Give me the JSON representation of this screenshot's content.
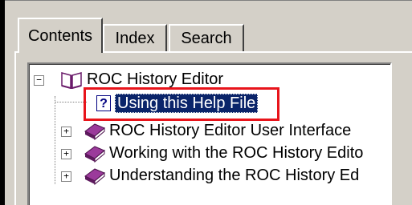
{
  "tabs": [
    {
      "label": "Contents",
      "active": true
    },
    {
      "label": "Index",
      "active": false
    },
    {
      "label": "Search",
      "active": false
    }
  ],
  "tree": {
    "root": {
      "label": "ROC History Editor",
      "icon": "open-book-icon",
      "expanded": true
    },
    "items": [
      {
        "label": "Using this Help File",
        "icon": "help-page-icon",
        "selected": true
      },
      {
        "label": "ROC History Editor User Interface",
        "icon": "closed-book-icon",
        "expanded": false
      },
      {
        "label": "Working with the ROC History Edito",
        "icon": "closed-book-icon",
        "expanded": false
      },
      {
        "label": "Understanding the ROC History Ed",
        "icon": "closed-book-icon",
        "expanded": false
      }
    ]
  },
  "colors": {
    "selection": "#0a246a",
    "highlight_box": "#e8141b",
    "book": "#7a2a7a",
    "panel": "#d4d0c8"
  }
}
